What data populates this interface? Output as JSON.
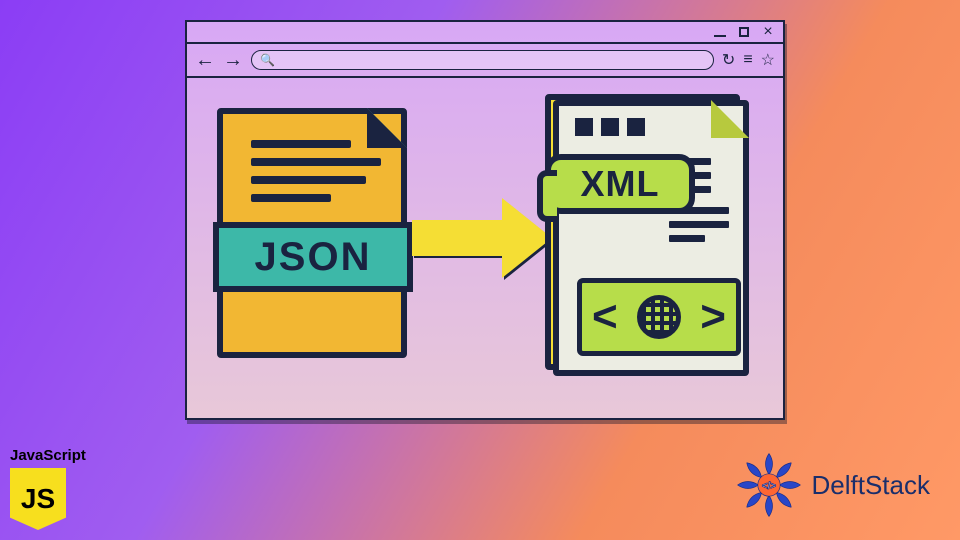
{
  "browser": {
    "window_controls": {
      "minimize": "minimize",
      "maximize": "maximize",
      "close": "×"
    }
  },
  "diagram": {
    "from_label": "JSON",
    "to_label": "XML"
  },
  "left_logo": {
    "title": "JavaScript",
    "shield": "JS"
  },
  "right_logo": {
    "text": "DelftStack"
  }
}
